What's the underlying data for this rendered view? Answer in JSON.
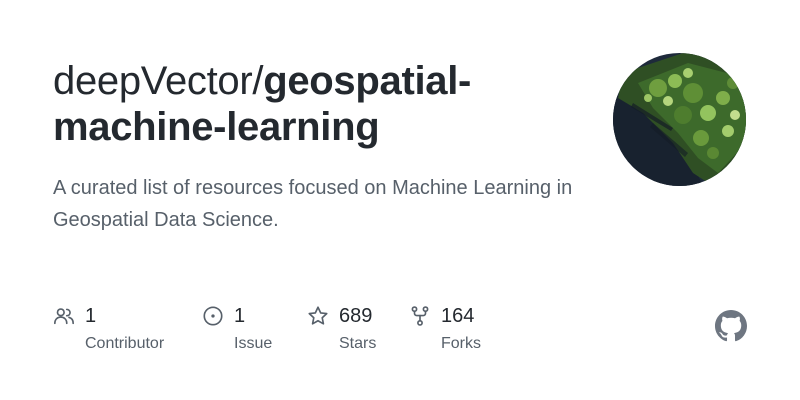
{
  "repo": {
    "owner_prefix": "deepVector/",
    "name": "geospatial-machine-learning",
    "description": "A curated list of resources focused on Machine Learning in Geospatial Data Science."
  },
  "avatar": {
    "icon": "aerial-forest-avatar",
    "colors": {
      "water": "#1f2a3a",
      "forest": "#3c6b2a",
      "canopy": "#7fae4a"
    }
  },
  "stats": [
    {
      "icon": "people-icon",
      "value": "1",
      "label": "Contributor"
    },
    {
      "icon": "issue-icon",
      "value": "1",
      "label": "Issue"
    },
    {
      "icon": "star-icon",
      "value": "689",
      "label": "Stars"
    },
    {
      "icon": "fork-icon",
      "value": "164",
      "label": "Forks"
    }
  ],
  "brand": {
    "icon": "github-icon",
    "color": "#6e7681"
  },
  "colors": {
    "title": "#24292f",
    "muted": "#57606a",
    "icon": "#57606a"
  }
}
